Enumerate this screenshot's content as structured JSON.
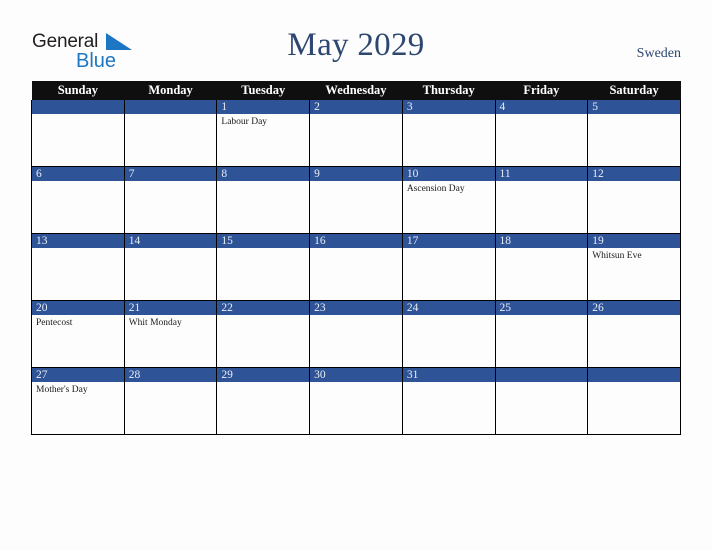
{
  "brand": {
    "word_one": "General",
    "word_two": "Blue",
    "accent_color": "#1c76c4",
    "text_color": "#231f20",
    "triangle_icon": "triangle-icon"
  },
  "header": {
    "title": "May 2029",
    "country": "Sweden",
    "title_color": "#2d4771"
  },
  "calendar": {
    "weekday_headers": [
      "Sunday",
      "Monday",
      "Tuesday",
      "Wednesday",
      "Thursday",
      "Friday",
      "Saturday"
    ],
    "header_bg": "#100f0f",
    "daybar_bg": "#2e5396",
    "daybar_text": "#e9eef6",
    "weeks": [
      [
        {
          "day": "",
          "events": []
        },
        {
          "day": "",
          "events": []
        },
        {
          "day": "1",
          "events": [
            "Labour Day"
          ]
        },
        {
          "day": "2",
          "events": []
        },
        {
          "day": "3",
          "events": []
        },
        {
          "day": "4",
          "events": []
        },
        {
          "day": "5",
          "events": []
        }
      ],
      [
        {
          "day": "6",
          "events": []
        },
        {
          "day": "7",
          "events": []
        },
        {
          "day": "8",
          "events": []
        },
        {
          "day": "9",
          "events": []
        },
        {
          "day": "10",
          "events": [
            "Ascension Day"
          ]
        },
        {
          "day": "11",
          "events": []
        },
        {
          "day": "12",
          "events": []
        }
      ],
      [
        {
          "day": "13",
          "events": []
        },
        {
          "day": "14",
          "events": []
        },
        {
          "day": "15",
          "events": []
        },
        {
          "day": "16",
          "events": []
        },
        {
          "day": "17",
          "events": []
        },
        {
          "day": "18",
          "events": []
        },
        {
          "day": "19",
          "events": [
            "Whitsun Eve"
          ]
        }
      ],
      [
        {
          "day": "20",
          "events": [
            "Pentecost"
          ]
        },
        {
          "day": "21",
          "events": [
            "Whit Monday"
          ]
        },
        {
          "day": "22",
          "events": []
        },
        {
          "day": "23",
          "events": []
        },
        {
          "day": "24",
          "events": []
        },
        {
          "day": "25",
          "events": []
        },
        {
          "day": "26",
          "events": []
        }
      ],
      [
        {
          "day": "27",
          "events": [
            "Mother's Day"
          ]
        },
        {
          "day": "28",
          "events": []
        },
        {
          "day": "29",
          "events": []
        },
        {
          "day": "30",
          "events": []
        },
        {
          "day": "31",
          "events": []
        },
        {
          "day": "",
          "events": []
        },
        {
          "day": "",
          "events": []
        }
      ]
    ]
  }
}
